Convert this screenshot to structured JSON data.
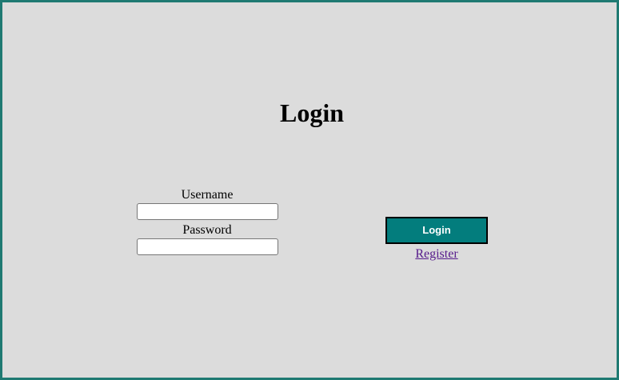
{
  "page": {
    "title": "Login"
  },
  "form": {
    "username_label": "Username",
    "username_value": "",
    "password_label": "Password",
    "password_value": ""
  },
  "actions": {
    "login_label": "Login",
    "register_label": "Register"
  },
  "colors": {
    "background": "#dcdcdc",
    "border": "#1f7a72",
    "button": "#037d7d",
    "link_visited": "#551a8b"
  }
}
